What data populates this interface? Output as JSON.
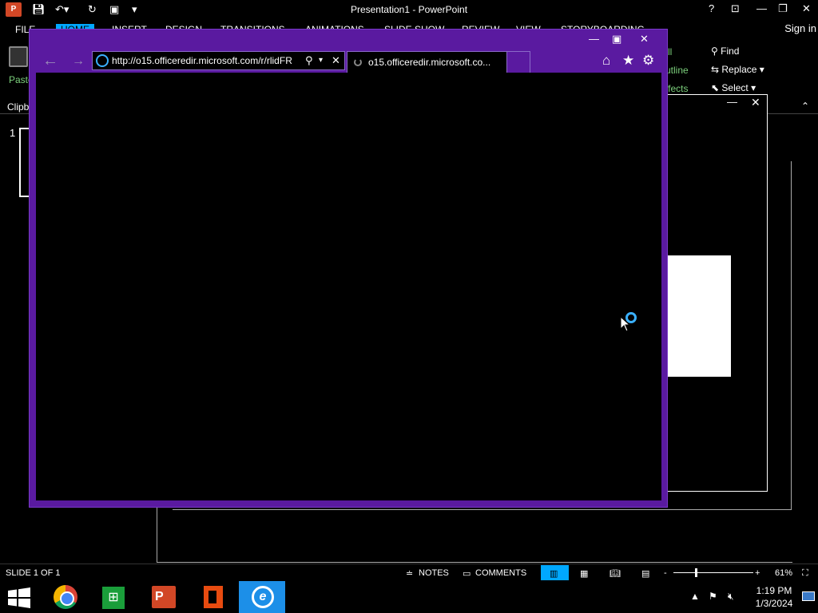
{
  "app": {
    "title": "Presentation1 - PowerPoint",
    "logo": "P",
    "sign_in": "Sign in"
  },
  "ribbon": {
    "tabs": [
      "FILE",
      "HOME",
      "INSERT",
      "DESIGN",
      "TRANSITIONS",
      "ANIMATIONS",
      "SLIDE SHOW",
      "REVIEW",
      "VIEW",
      "STORYBOARDING"
    ],
    "paste": "Paste",
    "clipboard": "Clipb",
    "fragments": [
      "ll",
      "utline",
      "ffects"
    ],
    "editing": {
      "find": "Find",
      "replace": "Replace",
      "select": "Select"
    }
  },
  "slides": {
    "thumb_number": "1"
  },
  "browser": {
    "address": "http://o15.officeredir.microsoft.com/r/rlidFR",
    "tab_title": "o15.officeredir.microsoft.co..."
  },
  "status": {
    "slide_info": "SLIDE 1 OF 1",
    "notes": "NOTES",
    "comments": "COMMENTS",
    "zoom_minus": "-",
    "zoom_plus": "+",
    "zoom": "61%"
  },
  "taskbar": {
    "time": "1:19 PM",
    "date": "1/3/2024",
    "ppt_label": "P",
    "ie_label": "e"
  },
  "colors": {
    "ie_frame": "#5a1aa0",
    "accent": "#00a8ff",
    "ppt_brand": "#d24726"
  }
}
